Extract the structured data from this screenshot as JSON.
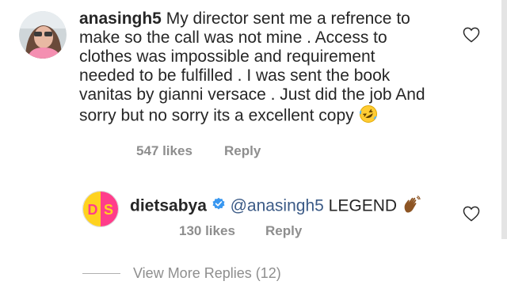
{
  "comment": {
    "username": "anasingh5",
    "text": "My director sent me a refrence to make so the call was not mine . Access to clothes was impossible and requirement needed to be fulfilled . I was sent the book vanitas by gianni versace . Just did the job And sorry but no sorry its a excellent copy",
    "emoji": "rolling-on-floor-laughing-emoji",
    "likes": "547 likes",
    "reply_label": "Reply"
  },
  "reply": {
    "username": "dietsabya",
    "avatar_initials_d": "D",
    "avatar_initials_s": "S",
    "verified": "verified-badge-icon",
    "mention": "@anasingh5",
    "text": "LEGEND",
    "emoji": "waving-hand-emoji",
    "likes": "130 likes",
    "reply_label": "Reply"
  },
  "view_more_replies": "View More Replies (12)",
  "colors": {
    "text": "#262626",
    "muted": "#8e8e8e",
    "mention": "#3b5a86",
    "verified": "#3897f0",
    "avatar_pink": "#ff3d8b",
    "avatar_yellow": "#ffd21f"
  }
}
